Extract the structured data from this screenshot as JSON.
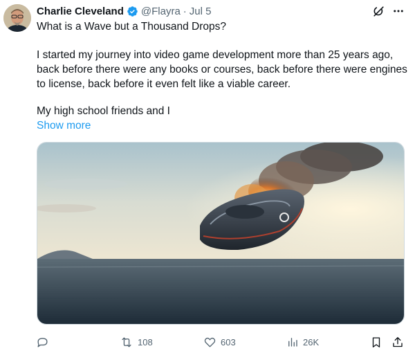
{
  "author": {
    "name": "Charlie Cleveland",
    "handle": "@Flayra",
    "separator": "·",
    "date": "Jul 5",
    "verified": true
  },
  "tweet": {
    "line1": "What is a Wave but a Thousand Drops?",
    "paragraph2": "I started my journey into video game development more than 25 years ago, back before there were any books or courses, back before there were engines to license, back before it even felt like a viable career.",
    "paragraph3": "My high school friends and I",
    "show_more": "Show more"
  },
  "media": {
    "description_icon": "image"
  },
  "actions": {
    "reply_count": "",
    "repost_count": "108",
    "like_count": "603",
    "view_count": "26K"
  },
  "colors": {
    "link": "#1d9bf0",
    "secondary_text": "#536471",
    "verified_badge": "#1d9bf0"
  },
  "icons": [
    "grok-icon",
    "more-icon",
    "verified-badge-icon",
    "reply-icon",
    "repost-icon",
    "like-icon",
    "views-icon",
    "bookmark-icon",
    "share-icon"
  ]
}
